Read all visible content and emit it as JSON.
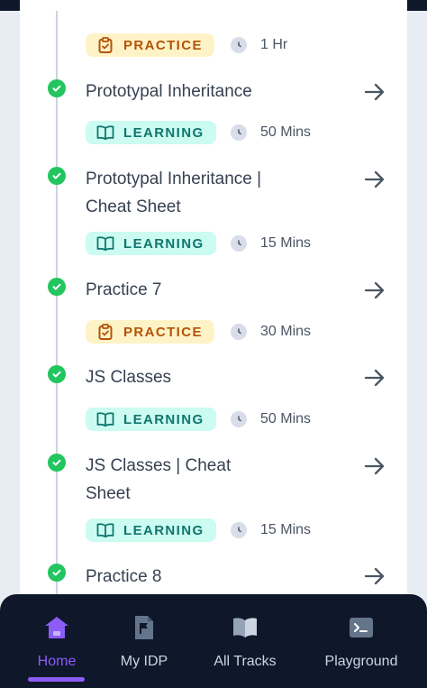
{
  "colors": {
    "accent": "#8b5cf6",
    "completed": "#22c55e",
    "learning_bg": "#ccfbf1",
    "learning_text": "#0f766e",
    "practice_bg": "#fef3c7",
    "practice_text": "#b45309",
    "nav_bg": "#0f172a"
  },
  "items": [
    {
      "title": "",
      "type": "PRACTICE",
      "type_icon": "clipboard-icon",
      "duration": "1 Hr"
    },
    {
      "title": "Prototypal Inheritance",
      "type": "LEARNING",
      "type_icon": "book-open-icon",
      "duration": "50 Mins"
    },
    {
      "title": "Prototypal Inheritance | Cheat Sheet",
      "type": "LEARNING",
      "type_icon": "book-open-icon",
      "duration": "15 Mins"
    },
    {
      "title": "Practice 7",
      "type": "PRACTICE",
      "type_icon": "clipboard-icon",
      "duration": "30 Mins"
    },
    {
      "title": "JS Classes",
      "type": "LEARNING",
      "type_icon": "book-open-icon",
      "duration": "50 Mins"
    },
    {
      "title": "JS Classes | Cheat Sheet",
      "type": "LEARNING",
      "type_icon": "book-open-icon",
      "duration": "15 Mins"
    },
    {
      "title": "Practice 8",
      "type": "",
      "type_icon": "",
      "duration": ""
    }
  ],
  "nav": {
    "items": [
      {
        "label": "Home",
        "icon": "home-icon",
        "active": true
      },
      {
        "label": "My IDP",
        "icon": "document-flag-icon",
        "active": false
      },
      {
        "label": "All Tracks",
        "icon": "book-icon",
        "active": false
      },
      {
        "label": "Playground",
        "icon": "terminal-icon",
        "active": false
      }
    ]
  }
}
